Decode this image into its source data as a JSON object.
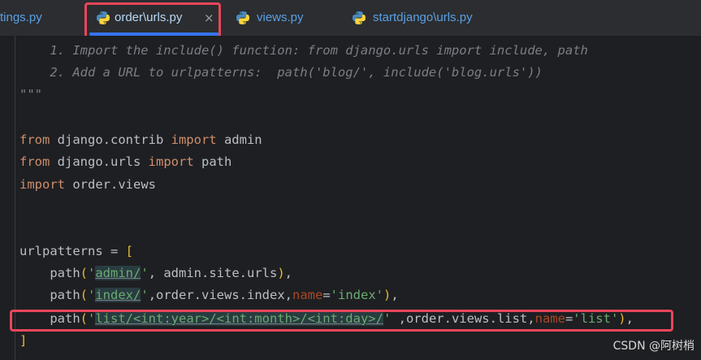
{
  "tabs": [
    {
      "label": "tings.py"
    },
    {
      "label": "order\\urls.py",
      "close": "×"
    },
    {
      "label": "views.py"
    },
    {
      "label": "startdjango\\urls.py"
    }
  ],
  "code": {
    "l1": "    1. Import the include() function: from django.urls import include, path",
    "l2": "    2. Add a URL to urlpatterns:  path('blog/', include('blog.urls'))",
    "l3": "\"\"\"",
    "l5_kw1": "from",
    "l5_mod": " django.contrib ",
    "l5_kw2": "import",
    "l5_name": " admin",
    "l6_kw1": "from",
    "l6_mod": " django.urls ",
    "l6_kw2": "import",
    "l6_name": " path",
    "l7_kw": "import",
    "l7_mod": " order.views",
    "l10_a": "urlpatterns = ",
    "l10_b": "[",
    "l11_fn": "    path",
    "l11_p1": "(",
    "l11_q1": "'",
    "l11_s": "admin/",
    "l11_q2": "'",
    "l11_rest": ", admin.site.urls",
    "l11_p2": ")",
    "l11_end": ",",
    "l12_fn": "    path",
    "l12_p1": "(",
    "l12_q1": "'",
    "l12_s": "index/",
    "l12_q2": "'",
    "l12_rest": ",order.views.index,",
    "l12_kw": "name",
    "l12_eq": "=",
    "l12_v": "'index'",
    "l12_p2": ")",
    "l12_end": ",",
    "l13_fn": "    path",
    "l13_p1": "(",
    "l13_q1": "'",
    "l13_s": "list/<int:year>/<int:month>/<int:day>/",
    "l13_q2": "'",
    "l13_rest": " ,order.views.list,",
    "l13_kw": "name",
    "l13_eq": "=",
    "l13_v": "'list'",
    "l13_p2": ")",
    "l13_end": ",",
    "l14": "]"
  },
  "watermark": "CSDN @阿树梢",
  "colors": {
    "background": "#1e1f22",
    "tab_text": "#5aa0e6",
    "highlight_red": "#e8465a",
    "keyword": "#cf8e6d",
    "string": "#6aab73",
    "comment": "#7a7e85"
  },
  "icons": {
    "tab_file": "python-icon",
    "close": "close-icon"
  }
}
